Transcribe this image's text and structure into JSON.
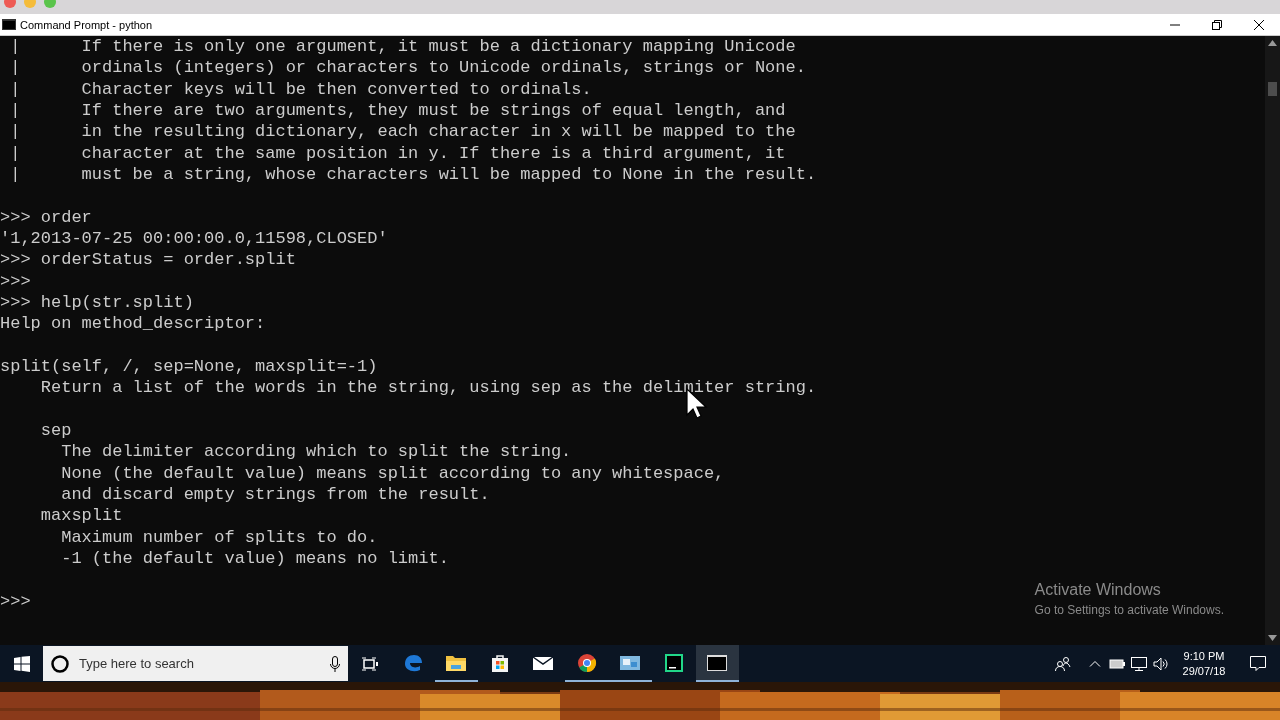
{
  "window": {
    "title": "Command Prompt - python"
  },
  "console": {
    "lines": [
      {
        "kind": "text",
        "text": " |      If there is only one argument, it must be a dictionary mapping Unicode"
      },
      {
        "kind": "text",
        "text": " |      ordinals (integers) or characters to Unicode ordinals, strings or None."
      },
      {
        "kind": "text",
        "text": " |      Character keys will be then converted to ordinals."
      },
      {
        "kind": "text",
        "text": " |      If there are two arguments, they must be strings of equal length, and"
      },
      {
        "kind": "text",
        "text": " |      in the resulting dictionary, each character in x will be mapped to the"
      },
      {
        "kind": "text",
        "text": " |      character at the same position in y. If there is a third argument, it"
      },
      {
        "kind": "text",
        "text": " |      must be a string, whose characters will be mapped to None in the result."
      },
      {
        "kind": "blank"
      },
      {
        "kind": "text",
        "text": ">>> order"
      },
      {
        "kind": "text",
        "text": "'1,2013-07-25 00:00:00.0,11598,CLOSED'"
      },
      {
        "kind": "text",
        "text": ">>> orderStatus = order.split"
      },
      {
        "kind": "text",
        "text": ">>>"
      },
      {
        "kind": "text",
        "text": ">>> help(str.split)"
      },
      {
        "kind": "text",
        "text": "Help on method_descriptor:"
      },
      {
        "kind": "blank"
      },
      {
        "kind": "text",
        "text": "split(self, /, sep=None, maxsplit=-1)"
      },
      {
        "kind": "text",
        "text": "    Return a list of the words in the string, using sep as the delimiter string."
      },
      {
        "kind": "blank"
      },
      {
        "kind": "text",
        "text": "    sep"
      },
      {
        "kind": "text",
        "text": "      The delimiter according which to split the string."
      },
      {
        "kind": "text",
        "text": "      None (the default value) means split according to any whitespace,"
      },
      {
        "kind": "text",
        "text": "      and discard empty strings from the result."
      },
      {
        "kind": "text",
        "text": "    maxsplit"
      },
      {
        "kind": "text",
        "text": "      Maximum number of splits to do."
      },
      {
        "kind": "text",
        "text": "      -1 (the default value) means no limit."
      },
      {
        "kind": "blank"
      },
      {
        "kind": "text",
        "text": ">>>"
      }
    ]
  },
  "activation_notice": {
    "title": "Activate Windows",
    "subtitle": "Go to Settings to activate Windows."
  },
  "taskbar": {
    "search": {
      "placeholder": "Type here to search"
    },
    "apps": [
      {
        "kind": "edge",
        "running": false,
        "selected": false
      },
      {
        "kind": "explorer",
        "running": true,
        "selected": false
      },
      {
        "kind": "store",
        "running": false,
        "selected": false
      },
      {
        "kind": "mail",
        "running": false,
        "selected": false
      },
      {
        "kind": "chrome",
        "running": true,
        "selected": false
      },
      {
        "kind": "app",
        "running": true,
        "selected": false
      },
      {
        "kind": "pycharm",
        "running": false,
        "selected": false
      },
      {
        "kind": "terminal",
        "running": true,
        "selected": true
      }
    ],
    "clock": {
      "time": "9:10 PM",
      "date": "29/07/18"
    }
  }
}
